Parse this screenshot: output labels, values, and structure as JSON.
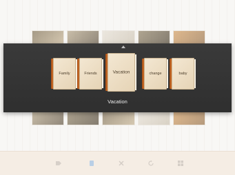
{
  "albums": [
    {
      "label": "Family"
    },
    {
      "label": "Friends"
    },
    {
      "label": "Vacation"
    },
    {
      "label": "change"
    },
    {
      "label": "baby"
    }
  ],
  "selected_album": "Vacation",
  "toolbar": {
    "icons": [
      "tag-icon",
      "share-icon",
      "delete-icon",
      "rotate-icon",
      "grid-icon"
    ]
  },
  "colors": {
    "overlay": "#333333",
    "album_spine": "#e0792d",
    "album_cover": "#f3e7d2"
  }
}
